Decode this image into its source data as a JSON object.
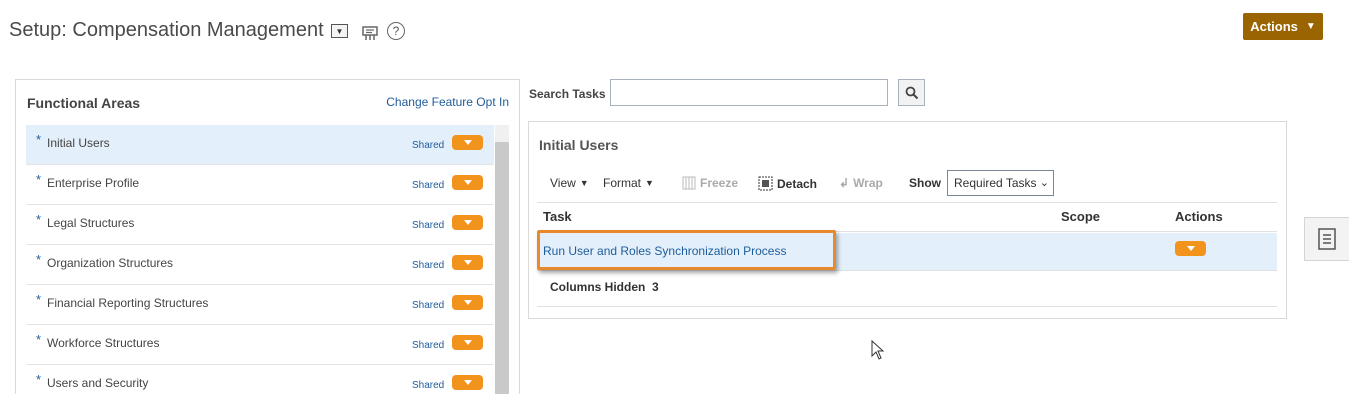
{
  "header": {
    "title": "Setup: Compensation Management",
    "actions_label": "Actions"
  },
  "functional_areas": {
    "title": "Functional Areas",
    "change_link": "Change Feature Opt In",
    "items": [
      {
        "star": "*",
        "label": "Initial Users",
        "shared": "Shared",
        "selected": true
      },
      {
        "star": "*",
        "label": "Enterprise Profile",
        "shared": "Shared"
      },
      {
        "star": "*",
        "label": "Legal Structures",
        "shared": "Shared"
      },
      {
        "star": "*",
        "label": "Organization Structures",
        "shared": "Shared"
      },
      {
        "star": "*",
        "label": "Financial Reporting Structures",
        "shared": "Shared"
      },
      {
        "star": "*",
        "label": "Workforce Structures",
        "shared": "Shared"
      },
      {
        "star": "*",
        "label": "Users and Security",
        "shared": "Shared"
      }
    ]
  },
  "search": {
    "label": "Search Tasks",
    "value": ""
  },
  "task_panel": {
    "title": "Initial Users",
    "toolbar": {
      "view": "View",
      "format": "Format",
      "freeze": "Freeze",
      "detach": "Detach",
      "wrap": "Wrap",
      "show": "Show",
      "show_value": "Required Tasks"
    },
    "columns": {
      "task": "Task",
      "scope": "Scope",
      "actions": "Actions"
    },
    "rows": [
      {
        "task": "Run User and Roles Synchronization Process"
      }
    ],
    "columns_hidden_label": "Columns Hidden",
    "columns_hidden_count": "3"
  },
  "colors": {
    "accent_actions": "#9a6400",
    "pill_orange": "#f2941c",
    "highlight": "#e8892b",
    "link": "#1f5c9a",
    "selected_row": "#e3f0fb"
  }
}
